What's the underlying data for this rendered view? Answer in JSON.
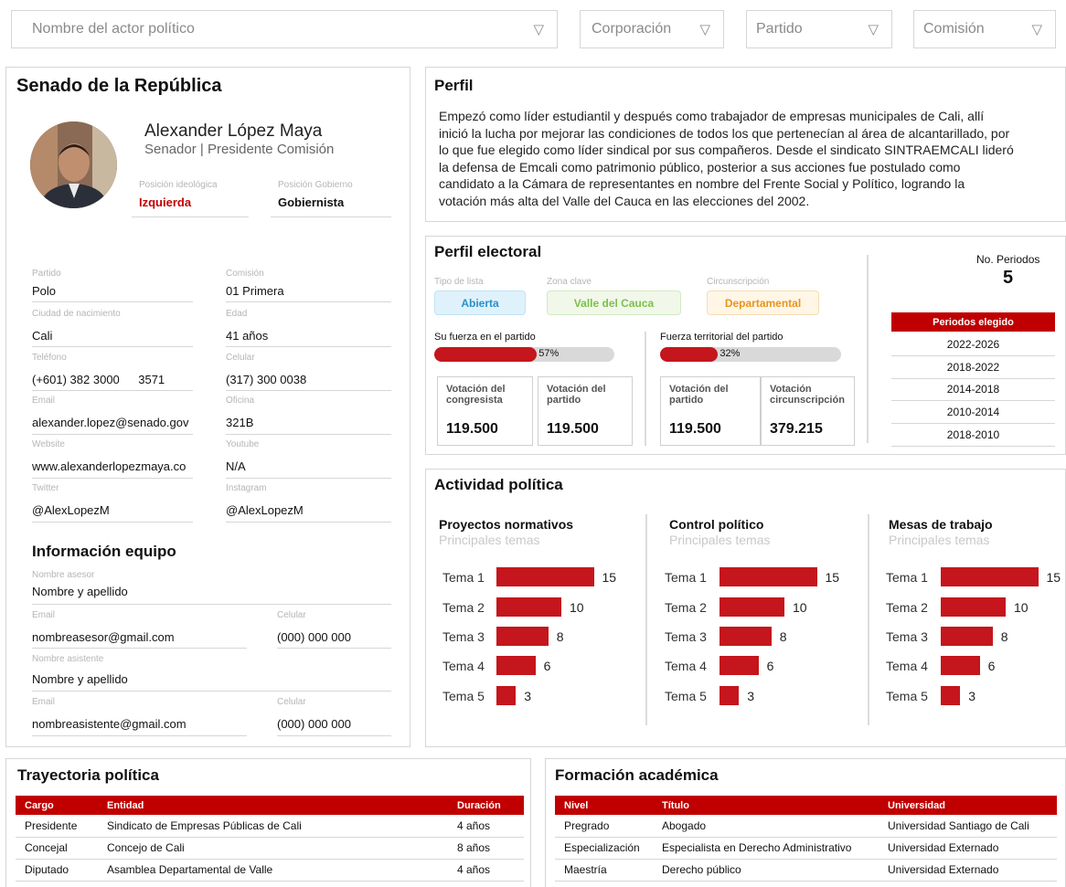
{
  "filters": {
    "actor": "Nombre del actor político",
    "corporacion": "Corporación",
    "partido": "Partido",
    "comision": "Comisión"
  },
  "profile": {
    "heading": "Senado de la República",
    "name": "Alexander López Maya",
    "role": "Senador | Presidente Comisión",
    "ideology_label": "Posición ideológica",
    "ideology_value": "Izquierda",
    "government_label": "Posición Gobierno",
    "government_value": "Gobiernista",
    "fields": {
      "partido_label": "Partido",
      "partido": "Polo",
      "comision_label": "Comisión",
      "comision": "01 Primera",
      "ciudad_label": "Ciudad de nacimiento",
      "ciudad": "Cali",
      "edad_label": "Edad",
      "edad": "41 años",
      "telefono_label": "Teléfono",
      "telefono": "(+601) 382 3000",
      "extension": "3571",
      "celular_label": "Celular",
      "celular": "(317) 300 0038",
      "email_label": "Email",
      "email": "alexander.lopez@senado.gov",
      "oficina_label": "Oficina",
      "oficina": "321B",
      "website_label": "Website",
      "website": "www.alexanderlopezmaya.co",
      "youtube_label": "Youtube",
      "youtube": "N/A",
      "twitter_label": "Twitter",
      "twitter": "@AlexLopezM",
      "instagram_label": "Instagram",
      "instagram": "@AlexLopezM"
    },
    "team": {
      "heading": "Información equipo",
      "asesor_label": "Nombre asesor",
      "asesor": "Nombre y apellido",
      "email1_label": "Email",
      "email1": "nombreasesor@gmail.com",
      "cel1_label": "Celular",
      "cel1": "(000) 000 000",
      "asistente_label": "Nombre asistente",
      "asistente": "Nombre y apellido",
      "email2_label": "Email",
      "email2": "nombreasistente@gmail.com",
      "cel2_label": "Celular",
      "cel2": "(000) 000 000"
    }
  },
  "perfil": {
    "heading": "Perfil",
    "lines": [
      "Empezó como líder estudiantil y después como trabajador de empresas municipales de Cali, allí",
      "inició la lucha por mejorar las condiciones de todos los que pertenecían al área de alcantarillado, por",
      "lo que fue elegido como líder sindical por sus compañeros. Desde el sindicato SINTRAEMCALI lideró",
      "la defensa de Emcali como patrimonio público, posterior a sus acciones fue postulado como",
      "candidato a la Cámara de representantes en nombre del Frente Social y Político, logrando la",
      "votación más alta del Valle del Cauca en las elecciones del 2002."
    ]
  },
  "electoral": {
    "heading": "Perfil electoral",
    "tipo_label": "Tipo de lista",
    "tipo": "Abierta",
    "zona_label": "Zona clave",
    "zona": "Valle del Cauca",
    "circ_label": "Circunscripción",
    "circ": "Departamental",
    "fuerza_partido_label": "Su fuerza en el partido",
    "fuerza_partido_pct": 57,
    "fuerza_partido_text": "57%",
    "fuerza_territorial_label": "Fuerza territorial del partido",
    "fuerza_territorial_pct": 32,
    "fuerza_territorial_text": "32%",
    "votes": [
      {
        "label": "Votación del congresista",
        "value": "119.500"
      },
      {
        "label": "Votación del partido",
        "value": "119.500"
      },
      {
        "label": "Votación del partido",
        "value": "119.500"
      },
      {
        "label": "Votación circunscripción",
        "value": "379.215"
      }
    ],
    "periodos_label": "No. Periodos",
    "periodos_value": "5",
    "elegido_header": "Periodos elegido",
    "elegido": [
      "2022-2026",
      "2018-2022",
      "2014-2018",
      "2010-2014",
      "2018-2010"
    ]
  },
  "actividad": {
    "heading": "Actividad política",
    "subtitle": "Principales temas"
  },
  "chart_data": [
    {
      "type": "bar",
      "title": "Proyectos normativos",
      "subtitle": "Principales temas",
      "categories": [
        "Tema 1",
        "Tema 2",
        "Tema 3",
        "Tema 4",
        "Tema 5"
      ],
      "values": [
        15,
        10,
        8,
        6,
        3
      ]
    },
    {
      "type": "bar",
      "title": "Control político",
      "subtitle": "Principales temas",
      "categories": [
        "Tema 1",
        "Tema 2",
        "Tema 3",
        "Tema 4",
        "Tema 5"
      ],
      "values": [
        15,
        10,
        8,
        6,
        3
      ]
    },
    {
      "type": "bar",
      "title": "Mesas de trabajo",
      "subtitle": "Principales temas",
      "categories": [
        "Tema 1",
        "Tema 2",
        "Tema 3",
        "Tema 4",
        "Tema 5"
      ],
      "values": [
        15,
        10,
        8,
        6,
        3
      ]
    }
  ],
  "trayectoria": {
    "heading": "Trayectoria política",
    "columns": [
      "Cargo",
      "Entidad",
      "Duración"
    ],
    "rows": [
      [
        "Presidente",
        "Sindicato de Empresas Públicas de Cali",
        "4 años"
      ],
      [
        "Concejal",
        "Concejo de Cali",
        "8 años"
      ],
      [
        "Diputado",
        "Asamblea Departamental de Valle",
        "4 años"
      ]
    ]
  },
  "formacion": {
    "heading": "Formación académica",
    "columns": [
      "Nivel",
      "Título",
      "Universidad"
    ],
    "rows": [
      [
        "Pregrado",
        "Abogado",
        "Universidad Santiago de Cali"
      ],
      [
        "Especialización",
        "Especialista en Derecho Administrativo",
        "Universidad Externado"
      ],
      [
        "Maestría",
        "Derecho público",
        "Universidad Externado"
      ]
    ]
  },
  "colors": {
    "accent": "#c4161c",
    "ideology": "#c00000",
    "pill_blue_bg": "#dff2fb",
    "pill_blue_fg": "#2a8fc8",
    "pill_green_bg": "#f1f8ea",
    "pill_green_fg": "#7cc04b",
    "pill_orange_bg": "#fff6e6",
    "pill_orange_fg": "#e8951c"
  }
}
